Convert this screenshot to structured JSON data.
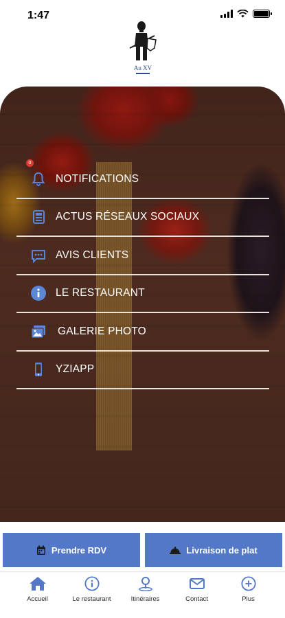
{
  "status_bar": {
    "time": "1:47"
  },
  "logo": {
    "text": "Au XV"
  },
  "menu": {
    "items": [
      {
        "label": "NOTIFICATIONS",
        "icon": "bell-icon",
        "badge": "0"
      },
      {
        "label": "ACTUS RÉSEAUX SOCIAUX",
        "icon": "newspaper-icon"
      },
      {
        "label": "AVIS CLIENTS",
        "icon": "comment-icon"
      },
      {
        "label": "LE RESTAURANT",
        "icon": "info-icon"
      },
      {
        "label": "GALERIE PHOTO",
        "icon": "images-icon"
      },
      {
        "label": "YZIAPP",
        "icon": "mobile-icon"
      }
    ]
  },
  "actions": {
    "rdv_label": "Prendre RDV",
    "livraison_label": "Livraison de plat"
  },
  "tabbar": {
    "items": [
      {
        "label": "Accueil",
        "icon": "home-icon"
      },
      {
        "label": "Le restaurant",
        "icon": "info-circle-icon"
      },
      {
        "label": "Itinéraires",
        "icon": "map-pin-icon"
      },
      {
        "label": "Contact",
        "icon": "envelope-icon"
      },
      {
        "label": "Plus",
        "icon": "plus-circle-icon"
      }
    ]
  },
  "colors": {
    "accent": "#5478c8",
    "icon_blue": "#5b86d6",
    "badge": "#e53935"
  }
}
